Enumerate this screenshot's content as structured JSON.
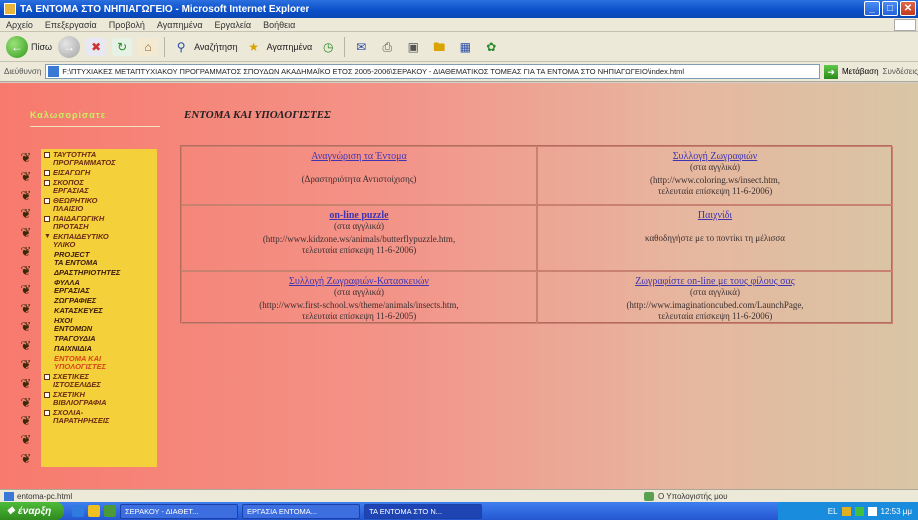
{
  "window": {
    "title": "ΤΑ ΕΝΤΟΜΑ ΣΤΟ ΝΗΠΙΑΓΩΓΕΙΟ - Microsoft Internet Explorer",
    "controls": [
      "_",
      "□",
      "✕"
    ]
  },
  "menu": [
    "Αρχείο",
    "Επεξεργασία",
    "Προβολή",
    "Αγαπημένα",
    "Εργαλεία",
    "Βοήθεια"
  ],
  "toolbar": {
    "back_label": "Πίσω",
    "search_label": "Αναζήτηση",
    "favorites_label": "Αγαπημένα"
  },
  "address": {
    "label": "Διεύθυνση",
    "url": "F:\\ΠΤΥΧΙΑΚΕΣ ΜΕΤΑΠΤΥΧΙΑΚΟΥ ΠΡΟΓΡΑΜΜΑΤΟΣ ΣΠΟΥΔΩΝ ΑΚΑΔΗΜΑΪΚΟ ΕΤΟΣ 2005-2006\\ΣΕΡΑΚΟΥ - ΔΙΑΘΕΜΑΤΙΚΟΣ ΤΟΜΕΑΣ ΓΙΑ ΤΑ ΕΝΤΟΜΑ ΣΤΟ ΝΗΠΙΑΓΩΓΕΙΟ\\index.html",
    "go_label": "Μετάβαση",
    "links_label": "Συνδέσεις"
  },
  "page": {
    "logo_text": "Καλωσορίσατε",
    "heading": "ΕΝΤΟΜΑ ΚΑΙ ΥΠΟΛΟΓΙΣΤΕΣ"
  },
  "sidebar": {
    "items": [
      {
        "label": "ΤΑΥΤΟΤΗΤΑ\nΠΡΟΓΡΑΜΜΑΤΟΣ",
        "marker": "box",
        "level": 0
      },
      {
        "label": "ΕΙΣΑΓΩΓΗ",
        "marker": "box",
        "level": 0
      },
      {
        "label": "ΣΚΟΠΟΣ\nΕΡΓΑΣΙΑΣ",
        "marker": "box",
        "level": 0
      },
      {
        "label": "ΘΕΩΡΗΤΙΚΟ\nΠΛΑΙΣΙΟ",
        "marker": "box",
        "level": 0
      },
      {
        "label": "ΠΑΙΔΑΓΩΓΙΚΗ\nΠΡΟΤΑΣΗ",
        "marker": "box",
        "level": 0
      },
      {
        "label": "ΕΚΠΑΙΔΕΥΤΙΚΟ\nΥΛΙΚΟ",
        "marker": "tri",
        "level": 0
      },
      {
        "label": "PROJECT\nΤΑ ΕΝΤΟΜΑ",
        "marker": "none",
        "level": 1
      },
      {
        "label": "ΔΡΑΣΤΗΡΙΟΤΗΤΕΣ",
        "marker": "none",
        "level": 1
      },
      {
        "label": "ΦΥΛΛΑ\nΕΡΓΑΣΙΑΣ",
        "marker": "none",
        "level": 1
      },
      {
        "label": "ΖΩΓΡΑΦΙΕΣ",
        "marker": "none",
        "level": 1
      },
      {
        "label": "ΚΑΤΑΣΚΕΥΕΣ",
        "marker": "none",
        "level": 1
      },
      {
        "label": "ΗΧΟΙ\nΕΝΤΟΜΩΝ",
        "marker": "none",
        "level": 1
      },
      {
        "label": "ΤΡΑΓΟΥΔΙΑ",
        "marker": "none",
        "level": 1
      },
      {
        "label": "ΠΑΙΧΝΙΔΙΑ",
        "marker": "none",
        "level": 1
      },
      {
        "label": "ΕΝΤΟΜΑ ΚΑΙ\nΥΠΟΛΟΓΙΣΤΕΣ",
        "marker": "none",
        "level": 1,
        "current": true
      },
      {
        "label": "ΣΧΕΤΙΚΕΣ\nΙΣΤΟΣΕΛΙΔΕΣ",
        "marker": "box",
        "level": 0
      },
      {
        "label": "ΣΧΕΤΙΚΗ\nΒΙΒΛΙΟΓΡΑΦΙΑ",
        "marker": "box",
        "level": 0
      },
      {
        "label": "ΣΧΟΛΙΑ-\nΠΑΡΑΤΗΡΗΣΕΙΣ",
        "marker": "box",
        "level": 0
      }
    ]
  },
  "links": [
    {
      "title": "Αναγνώριση τα Έντομα",
      "bold": false,
      "note": "",
      "desc": "(Δραστηριότητα Αντιστοίχισης)"
    },
    {
      "title": "Συλλογή Ζωγραφιών",
      "bold": false,
      "note": "(στα αγγλικά)",
      "desc": "(http://www.coloring.ws/insect.htm,\nτελευταία επίσκεψη 11-6-2006)"
    },
    {
      "title": "on-line puzzle",
      "bold": true,
      "note": "(στα αγγλικά)",
      "desc": "(http://www.kidzone.ws/animals/butterflypuzzle.htm,\nτελευταία επίσκεψη 11-6-2006)"
    },
    {
      "title": "Παιχνίδι",
      "bold": false,
      "note": "",
      "desc": "καθοδηγήστε με το ποντίκι τη μέλισσα"
    },
    {
      "title": "Συλλογή Ζωγραφιών-Κατασκευών",
      "bold": false,
      "note": "(στα αγγλικά)",
      "desc": "(http://www.first-school.ws/theme/animals/insects.htm,\nτελευταία επίσκεψη 11-6-2005)"
    },
    {
      "title": "Ζωγραφίστε on-line με τους φίλους σας",
      "bold": false,
      "note": "(στα αγγλικά)",
      "desc": "(http://www.imaginationcubed.com/LaunchPage,\nτελευταία επίσκεψη 11-6-2006)"
    }
  ],
  "status": {
    "left": "entoma-pc.html",
    "zone": "Ο Υπολογιστής μου"
  },
  "taskbar": {
    "start": "έναρξη",
    "tasks": [
      "ΣΕΡΑΚΟΥ - ΔΙΑΘΕΤ...",
      "ΕΡΓΑΣΙΑ ΕΝΤΟΜΑ...",
      "ΤΑ ΕΝΤΟΜΑ ΣΤΟ Ν..."
    ],
    "lang": "EL",
    "clock": "12:53 μμ"
  }
}
